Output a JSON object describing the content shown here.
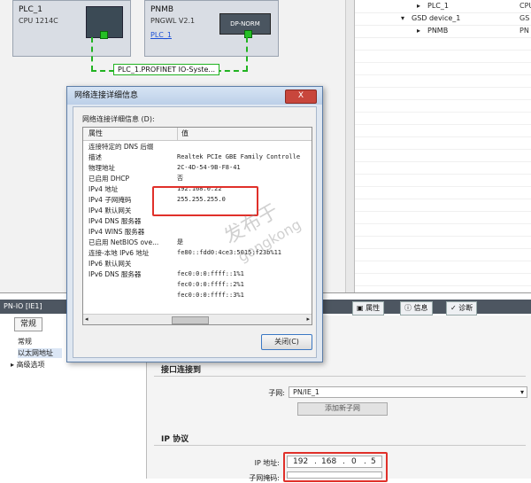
{
  "network": {
    "plc": {
      "name": "PLC_1",
      "cpu": "CPU 1214C"
    },
    "pnmb": {
      "name": "PNMB",
      "model": "PNGWL V2.1",
      "link": "PLC_1",
      "dp_label": "DP-NORM"
    },
    "bus_label": "PLC_1.PROFINET IO-Syste..."
  },
  "tree": {
    "rows": [
      {
        "label": "PLC_1",
        "col2": "CPU"
      },
      {
        "label": "GSD device_1",
        "col2": "GS"
      },
      {
        "label": "PNMB",
        "col2": "PN"
      }
    ]
  },
  "dialog": {
    "title": "网络连接详细信息",
    "close": "X",
    "caption": "网络连接详细信息 (D):",
    "col_property": "属性",
    "col_value": "值",
    "rows": [
      {
        "p": "连接特定的 DNS 后缀",
        "v": ""
      },
      {
        "p": "描述",
        "v": "Realtek PCIe GBE Family Controlle"
      },
      {
        "p": "物理地址",
        "v": "2C-4D-54-9B-F8-41"
      },
      {
        "p": "已启用 DHCP",
        "v": "否"
      },
      {
        "p": "IPv4 地址",
        "v": "192.168.0.22"
      },
      {
        "p": "IPv4 子网掩码",
        "v": "255.255.255.0"
      },
      {
        "p": "IPv4 默认网关",
        "v": ""
      },
      {
        "p": "IPv4 DNS 服务器",
        "v": ""
      },
      {
        "p": "IPv4 WINS 服务器",
        "v": ""
      },
      {
        "p": "已启用 NetBIOS ove...",
        "v": "是"
      },
      {
        "p": "连接-本地 IPv6 地址",
        "v": "fe80::fdd0:4ce3:5015:f23b%11"
      },
      {
        "p": "IPv6 默认网关",
        "v": ""
      },
      {
        "p": "IPv6 DNS 服务器",
        "v": "fec0:0:0:ffff::1%1"
      },
      {
        "p": "",
        "v": "fec0:0:0:ffff::2%1"
      },
      {
        "p": "",
        "v": "fec0:0:0:ffff::3%1"
      }
    ],
    "ok": "关闭(C)"
  },
  "bottom": {
    "pnio_title": "PN-IO [IE1]",
    "tabs": {
      "properties": "属性",
      "info": "信息",
      "diagnostics": "诊断"
    },
    "nav_tab": "常规",
    "nav_items": [
      "常规",
      "以太网地址",
      "高级选项"
    ],
    "section1": "接口连接到",
    "subnet_label": "子网:",
    "subnet_value": "PN/IE_1",
    "add_subnet": "添加新子网",
    "section2": "IP 协议",
    "ip_label": "IP 地址:",
    "ip_octets": [
      "192",
      "168",
      "0",
      "5"
    ],
    "mask_label": "子网掩码:"
  },
  "watermark": {
    "line1": "发布于",
    "line2": "gongkong"
  }
}
